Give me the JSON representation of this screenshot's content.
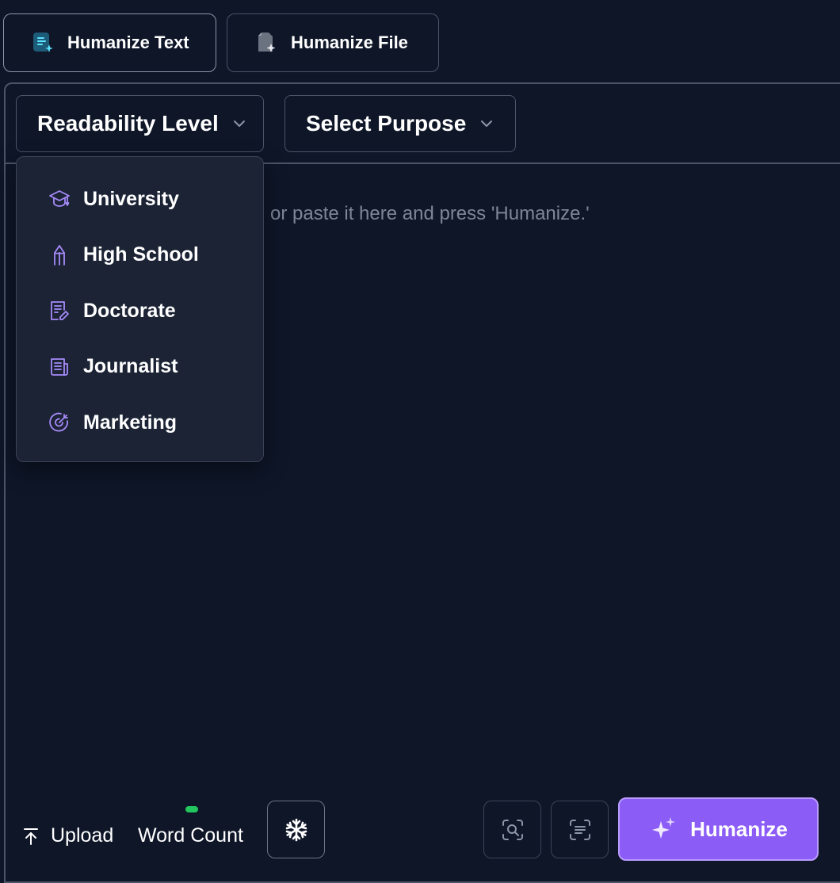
{
  "tabs": {
    "humanize_text": "Humanize Text",
    "humanize_file": "Humanize File"
  },
  "selects": {
    "readability": "Readability Level",
    "purpose": "Select Purpose"
  },
  "editor": {
    "placeholder_visible": "or paste it here and press 'Humanize.'"
  },
  "readability_menu": {
    "items": [
      {
        "label": "University",
        "icon": "graduation-cap-icon"
      },
      {
        "label": "High School",
        "icon": "pencil-icon"
      },
      {
        "label": "Doctorate",
        "icon": "document-edit-icon"
      },
      {
        "label": "Journalist",
        "icon": "newspaper-icon"
      },
      {
        "label": "Marketing",
        "icon": "target-icon"
      }
    ]
  },
  "footer": {
    "upload_label": "Upload",
    "word_count_label": "Word Count",
    "humanize_label": "Humanize"
  },
  "colors": {
    "background": "#0e1628",
    "border": "#4a5567",
    "dropdown_bg": "#1b2335",
    "menu_icon": "#a78bfa",
    "accent": "#8b5cf6",
    "status_green": "#22c55e"
  }
}
